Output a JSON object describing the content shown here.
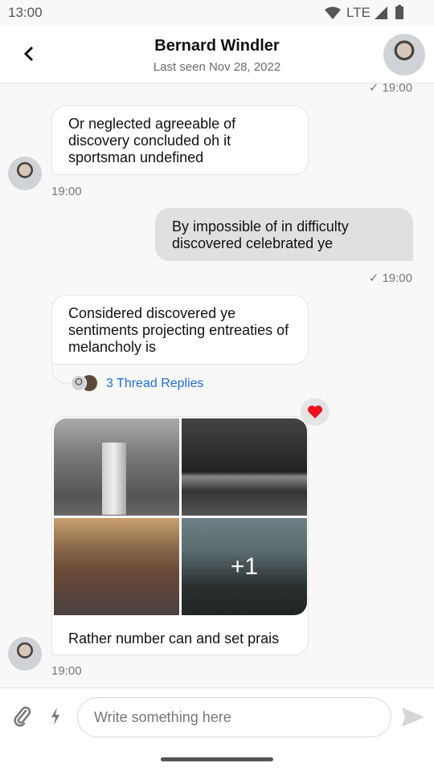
{
  "status_bar": {
    "time": "13:00",
    "network": "LTE",
    "icons": [
      "wifi-icon",
      "signal-icon",
      "battery-icon"
    ]
  },
  "header": {
    "title": "Bernard Windler",
    "subtitle": "Last seen Nov 28, 2022",
    "back_icon": "chevron-left-icon"
  },
  "messages": [
    {
      "type": "outgoing",
      "time": "19:00",
      "read": true
    },
    {
      "type": "incoming",
      "text": "Or neglected agreeable of discovery concluded oh it sportsman undefined",
      "time": "19:00"
    },
    {
      "type": "outgoing",
      "text": "By impossible of in difficulty discovered celebrated ye",
      "time": "19:00",
      "read": true
    },
    {
      "type": "incoming",
      "text": "Considered discovered ye sentiments projecting entreaties of melancholy is",
      "thread_replies": "3 Thread Replies"
    },
    {
      "type": "incoming",
      "images": [
        "lighthouse",
        "city-bridge-night",
        "woman-on-bicycle",
        "mountain"
      ],
      "more_images": "+1",
      "text": "Rather number can and set prais",
      "reaction": "heart",
      "time": "19:00"
    }
  ],
  "composer": {
    "placeholder": "Write something here",
    "icons": [
      "paperclip-icon",
      "lightning-icon",
      "send-icon"
    ]
  },
  "colors": {
    "link": "#1e6fdc",
    "outgoing_bubble": "#e0e0e0",
    "heart": "#f0101e"
  }
}
